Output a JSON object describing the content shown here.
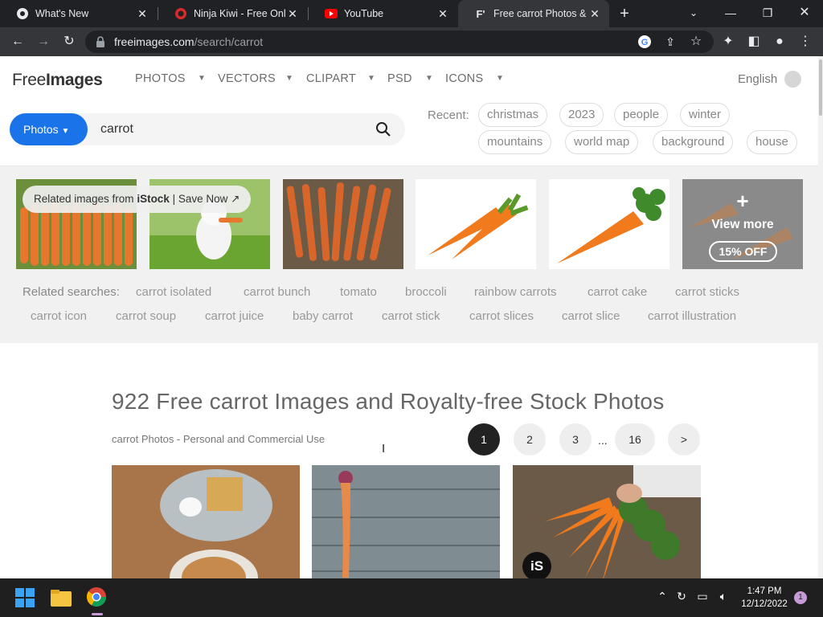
{
  "browser": {
    "tabs": [
      {
        "title": "What's New",
        "icon": "chrome-icon"
      },
      {
        "title": "Ninja Kiwi - Free Online",
        "icon": "ninja-kiwi-icon"
      },
      {
        "title": "YouTube",
        "icon": "youtube-icon"
      },
      {
        "title": "Free carrot Photos & Pi",
        "icon": "freeimages-icon"
      }
    ],
    "url_domain": "freeimages.com",
    "url_path": "/search/carrot"
  },
  "site": {
    "logo_light": "Free",
    "logo_bold": "Images",
    "nav": [
      "PHOTOS",
      "VECTORS",
      "CLIPART",
      "PSD",
      "ICONS"
    ],
    "language": "English",
    "search_category": "Photos",
    "search_query": "carrot",
    "recent_label": "Recent:",
    "recent": [
      "christmas",
      "2023",
      "people",
      "winter",
      "mountains",
      "world map",
      "background",
      "house"
    ]
  },
  "related": {
    "istock_prefix": "Related images from ",
    "istock_brand": "iStock",
    "istock_suffix": " | Save Now",
    "view_more": "View more",
    "discount": "15% OFF",
    "plus": "+",
    "searches_label": "Related searches:",
    "searches": [
      "carrot isolated",
      "carrot bunch",
      "tomato",
      "broccoli",
      "rainbow carrots",
      "carrot cake",
      "carrot sticks",
      "carrot icon",
      "carrot soup",
      "carrot juice",
      "baby carrot",
      "carrot stick",
      "carrot slices",
      "carrot slice",
      "carrot illustration"
    ]
  },
  "results": {
    "title": "922 Free carrot Images and Royalty-free Stock Photos",
    "subtitle": "carrot Photos - Personal and Commercial Use",
    "pages": [
      "1",
      "2",
      "3",
      "16",
      ">"
    ],
    "dots": "...",
    "is_badge": "iS"
  },
  "taskbar": {
    "time": "1:47 PM",
    "date": "12/12/2022",
    "notifications": "1"
  },
  "colors": {
    "accent": "#1a73e8",
    "chrome_dark": "#202124",
    "carrot": "#e8772e"
  }
}
